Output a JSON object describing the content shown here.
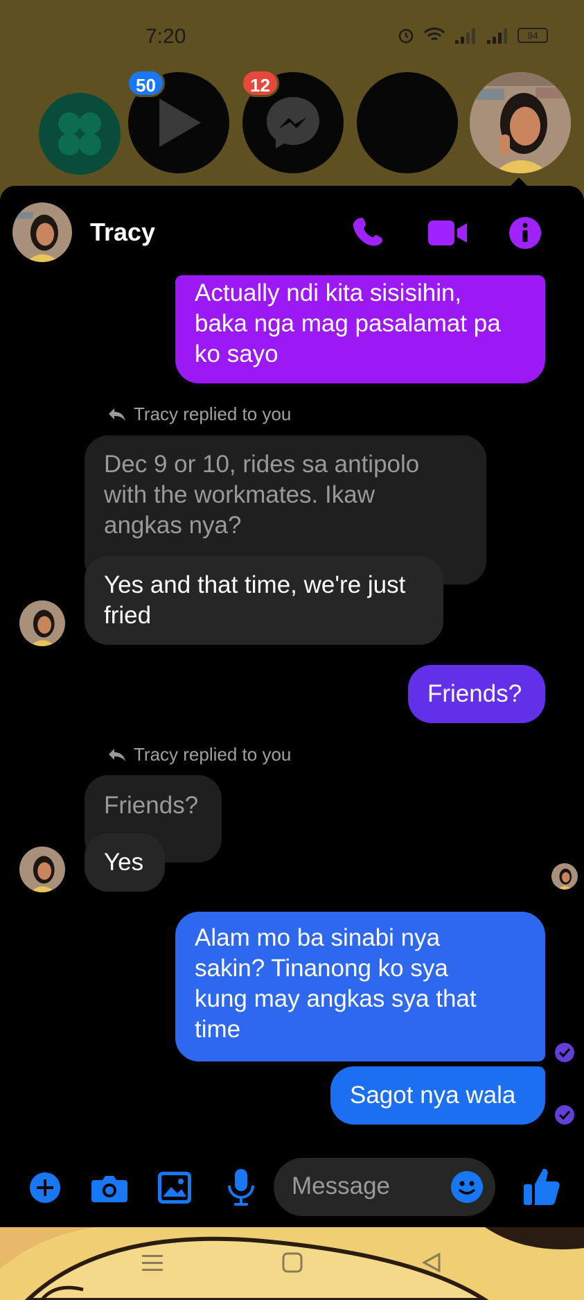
{
  "status_bar": {
    "time": "7:20",
    "battery": "94",
    "icons": [
      "alarm-icon",
      "wifi-icon",
      "signal-icon",
      "signal-icon"
    ]
  },
  "chat_heads": [
    {
      "name": "app-head-green",
      "icon": "grid-icon"
    },
    {
      "name": "app-head-video",
      "icon": "play-icon",
      "badge": "50"
    },
    {
      "name": "app-head-messenger",
      "icon": "messenger-icon",
      "badge": "12"
    },
    {
      "name": "app-head-dark",
      "icon": "none"
    },
    {
      "name": "chat-head-tracy",
      "icon": "avatar"
    }
  ],
  "header": {
    "name": "Tracy",
    "icons": [
      "phone-icon",
      "video-call-icon",
      "info-icon"
    ]
  },
  "messages": [
    {
      "side": "out",
      "text": "Actually ndi kita sisisihin,\nbaka nga mag pasalamat pa\nko sayo"
    },
    {
      "reply_note": "Tracy replied to you"
    },
    {
      "side": "quote",
      "text": "Dec 9 or 10, rides sa antipolo\nwith the workmates. Ikaw\nangkas nya?"
    },
    {
      "side": "in",
      "text": "Yes and that time, we're just\nfried"
    },
    {
      "side": "out",
      "text": "Friends?"
    },
    {
      "reply_note": "Tracy replied to you"
    },
    {
      "side": "quote",
      "text": "Friends?"
    },
    {
      "side": "in",
      "text": "Yes"
    },
    {
      "side": "out",
      "text": "Alam mo ba sinabi nya\nsakin? Tinanong ko sya\nkung may angkas sya that\ntime"
    },
    {
      "side": "out",
      "text": "Sagot nya wala"
    }
  ],
  "composer": {
    "placeholder": "Message",
    "icons": [
      "plus-icon",
      "camera-icon",
      "gallery-icon",
      "mic-icon",
      "emoji-icon",
      "thumbs-up-icon"
    ]
  },
  "colors": {
    "accent": "#9b19f5",
    "bubble_gradient": [
      "#9b19f5",
      "#6230e8",
      "#2e68ee",
      "#1c6ff0"
    ],
    "badge_blue": "#1877f2",
    "badge_red": "#e8473b",
    "composer_blue": "#1877f2"
  }
}
